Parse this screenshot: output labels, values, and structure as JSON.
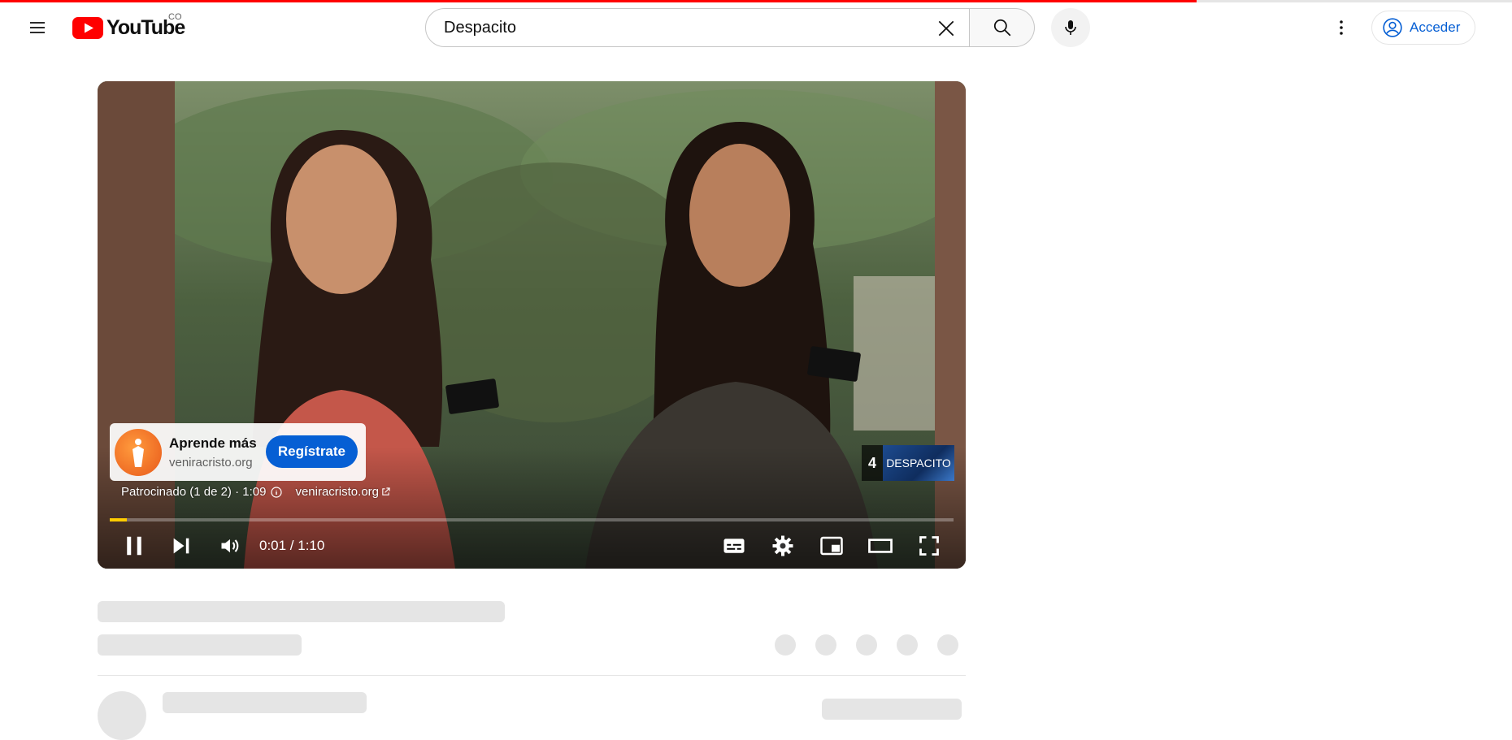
{
  "header": {
    "logo_text": "YouTube",
    "country_code": "CO",
    "search_value": "Despacito",
    "signin_label": "Acceder"
  },
  "player": {
    "ad": {
      "title": "Aprende más",
      "domain": "veniracristo.org",
      "cta_label": "Regístrate",
      "sponsored_text": "Patrocinado (1 de 2) · 1:09",
      "link_text": "veniracristo.org"
    },
    "end_screen": {
      "number": "4",
      "thumb_label": "DESPACITO"
    },
    "time_display": "0:01 / 1:10",
    "progress_fraction": 0.02
  },
  "colors": {
    "brand_red": "#ff0000",
    "link_blue": "#065fd4",
    "progress_yellow": "#ffcc00",
    "skeleton": "#e5e5e5"
  },
  "icons": [
    "menu-icon",
    "youtube-logo-icon",
    "close-icon",
    "search-icon",
    "mic-icon",
    "more-vert-icon",
    "account-icon",
    "pause-icon",
    "next-icon",
    "volume-icon",
    "subtitles-icon",
    "settings-icon",
    "miniplayer-icon",
    "theater-icon",
    "fullscreen-icon",
    "info-icon",
    "external-link-icon"
  ]
}
